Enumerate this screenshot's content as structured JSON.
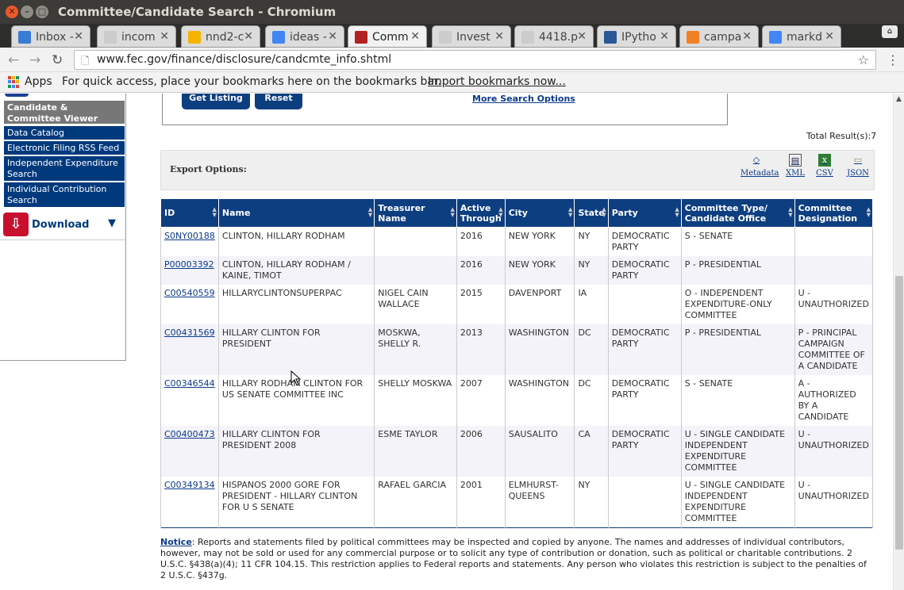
{
  "window": {
    "title": "Committee/Candidate Search - Chromium"
  },
  "tabs": [
    {
      "label": "Inbox -",
      "icon": "inbox-icon",
      "color": "#3a7bd5"
    },
    {
      "label": "incom",
      "icon": "page-icon",
      "color": "#cccccc"
    },
    {
      "label": "nnd2-c",
      "icon": "drive-icon",
      "color": "#f4b400"
    },
    {
      "label": "ideas -",
      "icon": "docs-icon",
      "color": "#4285f4"
    },
    {
      "label": "Comm",
      "icon": "fec-seal-icon",
      "color": "#b22222"
    },
    {
      "label": "Invest",
      "icon": "page-icon",
      "color": "#cccccc"
    },
    {
      "label": "4418.p",
      "icon": "page-icon",
      "color": "#cccccc"
    },
    {
      "label": "IPytho",
      "icon": "stackoverflow-icon",
      "color": "#2b5797"
    },
    {
      "label": "campa",
      "icon": "loading-icon",
      "color": "#f48024"
    },
    {
      "label": "markd",
      "icon": "google-icon",
      "color": "#4285f4"
    }
  ],
  "toolbar": {
    "back": "←",
    "forward": "→",
    "reload": "↻",
    "url": "www.fec.gov/finance/disclosure/candcmte_info.shtml"
  },
  "bookmarks": {
    "apps": "Apps",
    "hint": "For quick access, place your bookmarks here on the bookmarks bar.",
    "import": "Import bookmarks now..."
  },
  "sidebar": {
    "items": [
      {
        "label": "Candidate & Committee Viewer",
        "current": true
      },
      {
        "label": "Data Catalog"
      },
      {
        "label": "Electronic Filing RSS Feed"
      },
      {
        "label": "Independent Expenditure Search"
      },
      {
        "label": "Individual Contribution Search"
      }
    ],
    "download": "Download"
  },
  "search": {
    "get_listing": "Get Listing",
    "reset": "Reset",
    "more_options": "More Search Options"
  },
  "total_results": "Total Result(s):7",
  "export": {
    "label": "Export Options:",
    "options": [
      "Metadata",
      "XML",
      "CSV",
      "JSON"
    ]
  },
  "table": {
    "headers": [
      "ID",
      "Name",
      "Treasurer Name",
      "Active Through",
      "City",
      "State",
      "Party",
      "Committee Type/ Candidate Office",
      "Committee Designation"
    ],
    "rows": [
      [
        "S0NY00188",
        "CLINTON, HILLARY RODHAM",
        "",
        "2016",
        "NEW YORK",
        "NY",
        "DEMOCRATIC PARTY",
        "S - SENATE",
        ""
      ],
      [
        "P00003392",
        "CLINTON, HILLARY RODHAM / KAINE, TIMOT",
        "",
        "2016",
        "NEW YORK",
        "NY",
        "DEMOCRATIC PARTY",
        "P - PRESIDENTIAL",
        ""
      ],
      [
        "C00540559",
        "HILLARYCLINTONSUPERPAC",
        "NIGEL CAIN WALLACE",
        "2015",
        "DAVENPORT",
        "IA",
        "",
        "O - INDEPENDENT EXPENDITURE-ONLY COMMITTEE",
        "U - UNAUTHORIZED"
      ],
      [
        "C00431569",
        "HILLARY CLINTON FOR PRESIDENT",
        "MOSKWA, SHELLY R.",
        "2013",
        "WASHINGTON",
        "DC",
        "DEMOCRATIC PARTY",
        "P - PRESIDENTIAL",
        "P - PRINCIPAL CAMPAIGN COMMITTEE OF A CANDIDATE"
      ],
      [
        "C00346544",
        "HILLARY RODHAM CLINTON FOR US SENATE COMMITTEE INC",
        "SHELLY MOSKWA",
        "2007",
        "WASHINGTON",
        "DC",
        "DEMOCRATIC PARTY",
        "S - SENATE",
        "A - AUTHORIZED BY A CANDIDATE"
      ],
      [
        "C00400473",
        "HILLARY CLINTON FOR PRESIDENT 2008",
        "ESME TAYLOR",
        "2006",
        "SAUSALITO",
        "CA",
        "DEMOCRATIC PARTY",
        "U - SINGLE CANDIDATE INDEPENDENT EXPENDITURE COMMITTEE",
        "U - UNAUTHORIZED"
      ],
      [
        "C00349134",
        "HISPANOS 2000 GORE FOR PRESIDENT - HILLARY CLINTON FOR U S SENATE",
        "RAFAEL GARCIA",
        "2001",
        "ELMHURST-QUEENS",
        "NY",
        "",
        "U - SINGLE CANDIDATE INDEPENDENT EXPENDITURE COMMITTEE",
        "U - UNAUTHORIZED"
      ]
    ]
  },
  "notice": {
    "label": "Notice",
    "text": ": Reports and statements filed by political committees may be inspected and copied by anyone. The names and addresses of individual contributors, however, may not be sold or used for any commercial purpose or to solicit any type of contribution or donation, such as political or charitable contributions. 2 U.S.C. §438(a)(4); 11 CFR 104.15. This restriction applies to Federal reports and statements. Any person who violates this restriction is subject to the penalties of 2 U.S.C. §437g."
  }
}
